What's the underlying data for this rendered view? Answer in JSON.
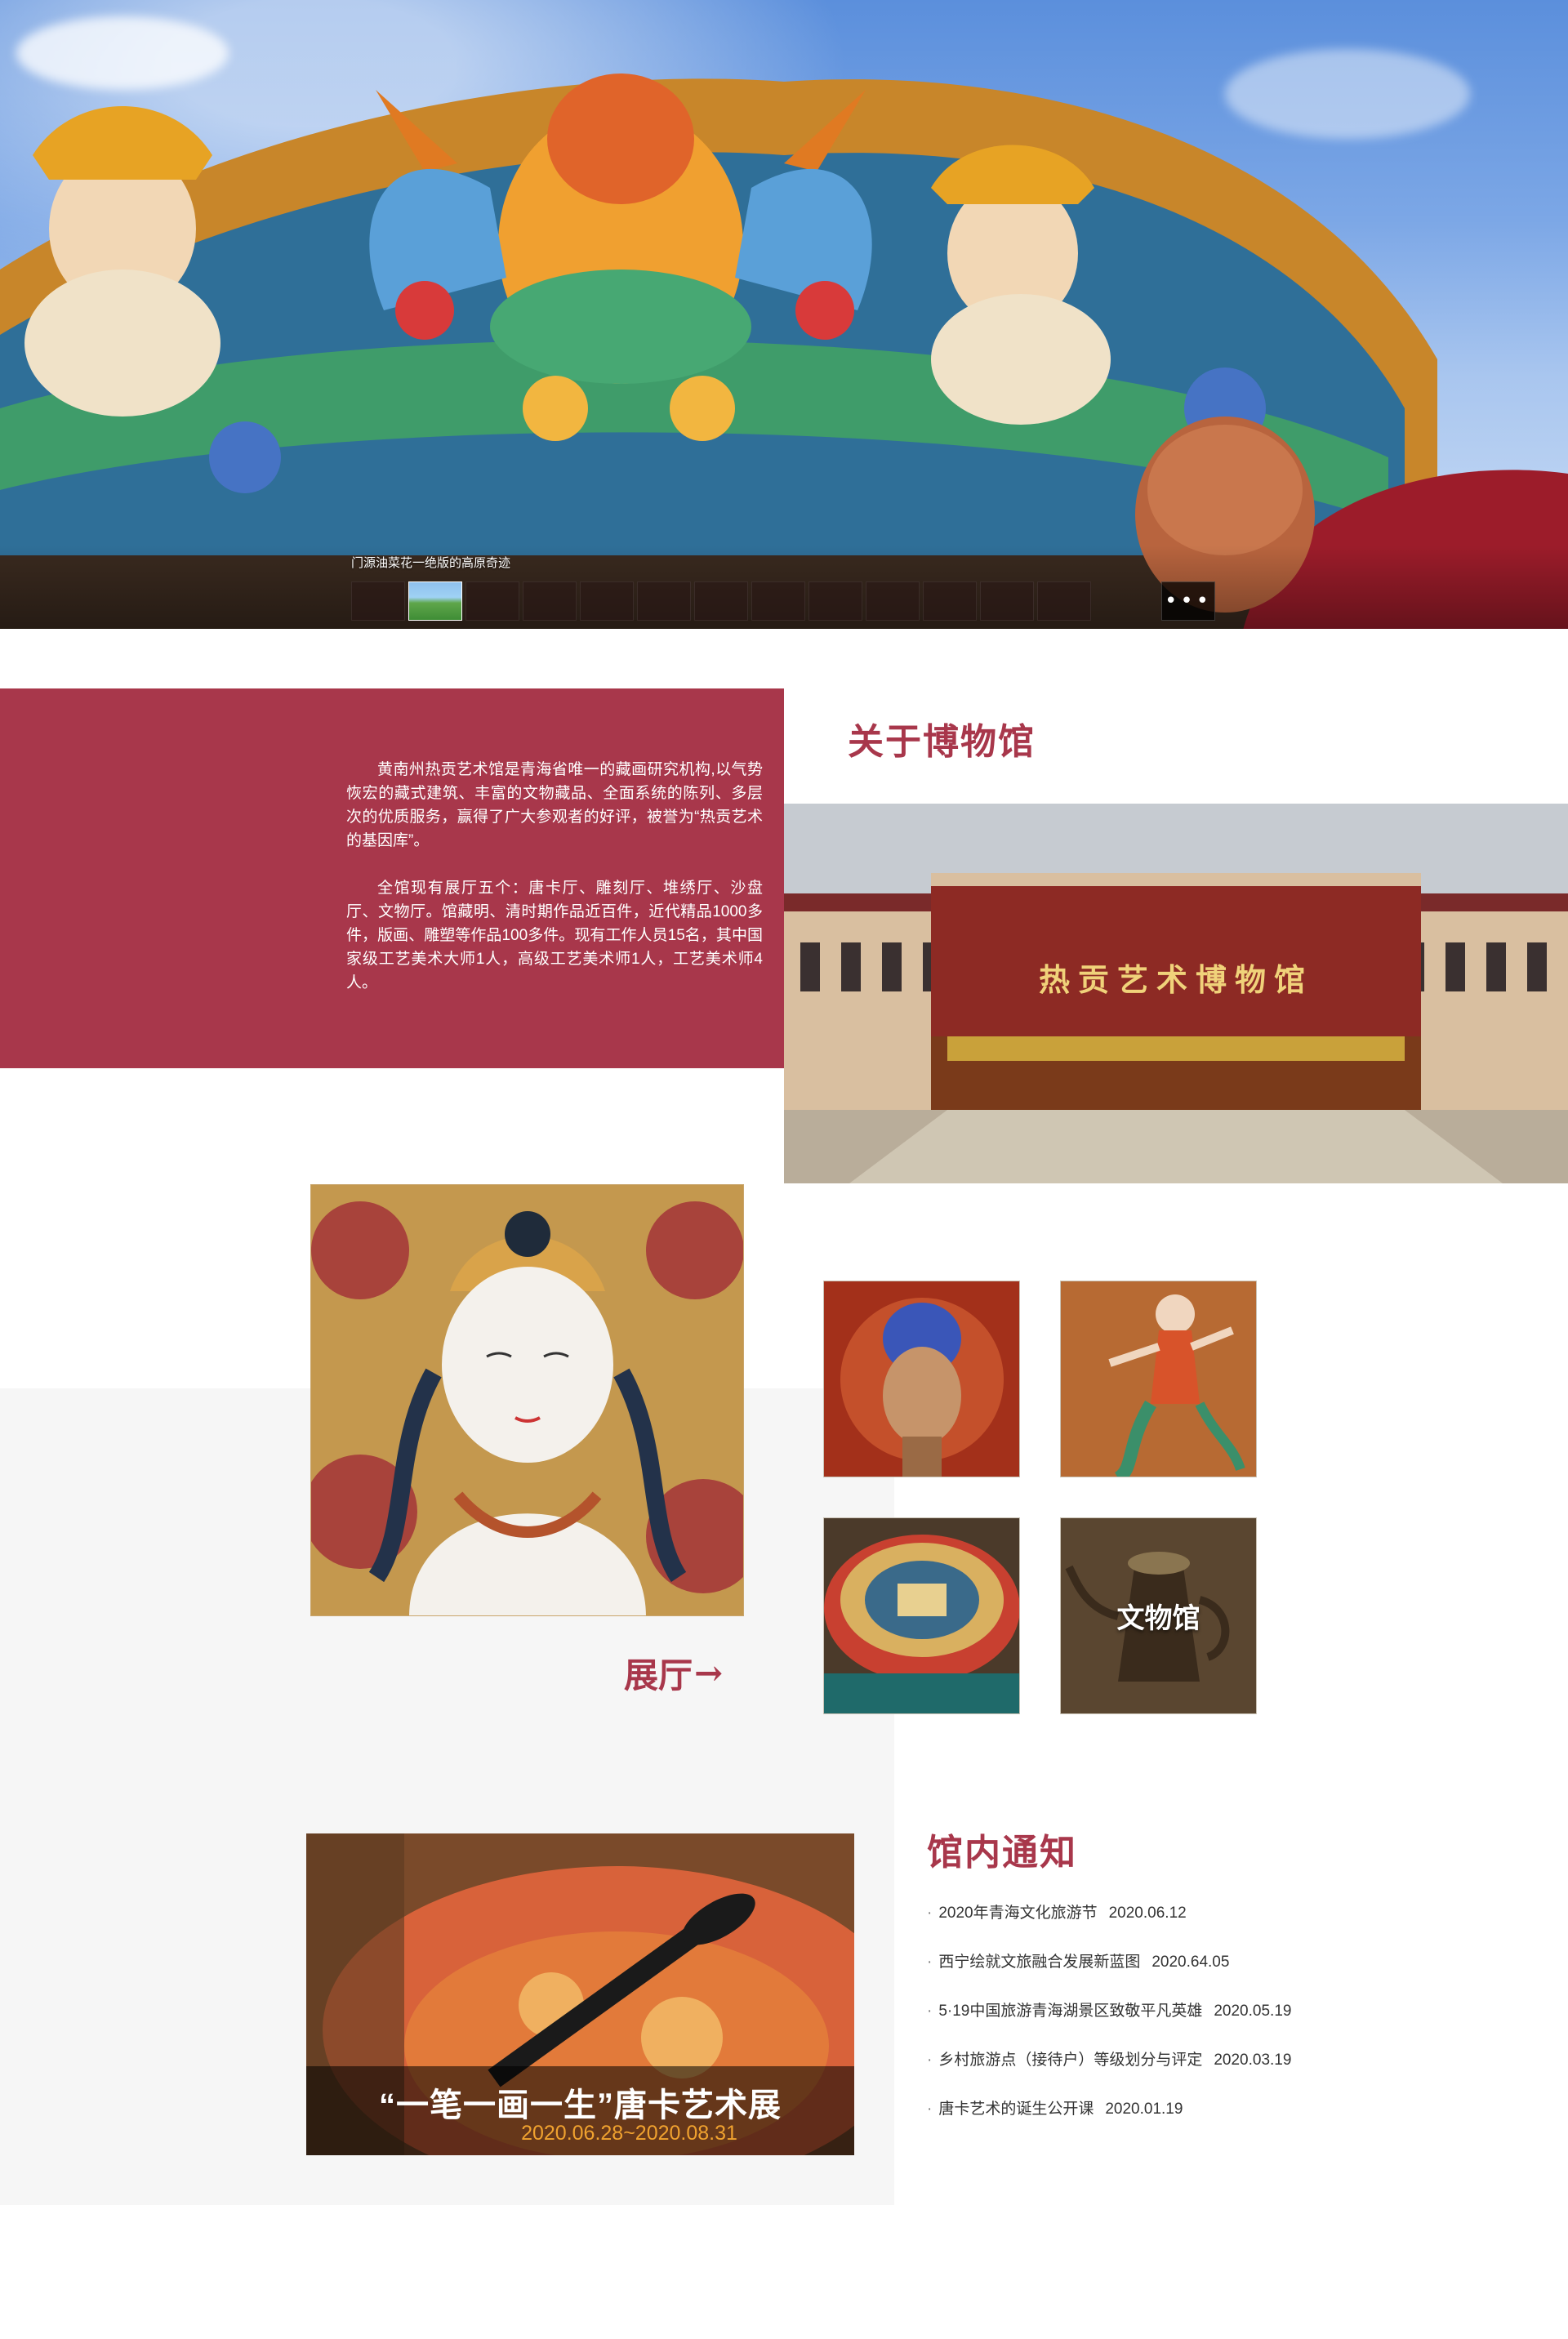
{
  "hero": {
    "caption": "门源油菜花一绝版的高原奇迹",
    "thumbnails": [
      {
        "state": "inactive"
      },
      {
        "state": "inactive"
      },
      {
        "state": "active"
      },
      {
        "state": "inactive"
      },
      {
        "state": "inactive"
      },
      {
        "state": "inactive"
      },
      {
        "state": "inactive"
      },
      {
        "state": "inactive"
      },
      {
        "state": "inactive"
      },
      {
        "state": "inactive"
      },
      {
        "state": "inactive"
      },
      {
        "state": "inactive"
      },
      {
        "state": "inactive"
      },
      {
        "state": "inactive"
      }
    ],
    "more_label": "•••"
  },
  "about": {
    "title": "关于博物馆",
    "paragraph_1": "黄南州热贡艺术馆是青海省唯一的藏画研究机构,以气势恢宏的藏式建筑、丰富的文物藏品、全面系统的陈列、多层次的优质服务，赢得了广大参观者的好评，被誉为“热贡艺术的基因库”。",
    "paragraph_2": "全馆现有展厅五个：唐卡厅、雕刻厅、堆绣厅、沙盘厅、文物厅。馆藏明、清时期作品近百件，近代精品1000多件，版画、雕塑等作品100多件。现有工作人员15名，其中国家级工艺美术大师1人，高级工艺美术师1人，工艺美术师4人。",
    "building_sign": "热贡艺术博物馆"
  },
  "gallery": {
    "hall_link": "展厅",
    "hall_arrow": "→",
    "tiles": [
      {
        "label": ""
      },
      {
        "label": ""
      },
      {
        "label": ""
      },
      {
        "label": "文物馆"
      }
    ]
  },
  "exhibition": {
    "title": "“一笔一画一生”唐卡艺术展",
    "date": "2020.06.28~2020.08.31"
  },
  "notices": {
    "title": "馆内通知",
    "bullet": "·",
    "items": [
      {
        "text": "2020年青海文化旅游节",
        "date": "2020.06.12"
      },
      {
        "text": "西宁绘就文旅融合发展新蓝图",
        "date": "2020.64.05"
      },
      {
        "text": "5·19中国旅游青海湖景区致敬平凡英雄",
        "date": "2020.05.19"
      },
      {
        "text": "乡村旅游点（接待户）等级划分与评定",
        "date": "2020.03.19"
      },
      {
        "text": "唐卡艺术的诞生公开课",
        "date": "2020.01.19"
      }
    ]
  }
}
